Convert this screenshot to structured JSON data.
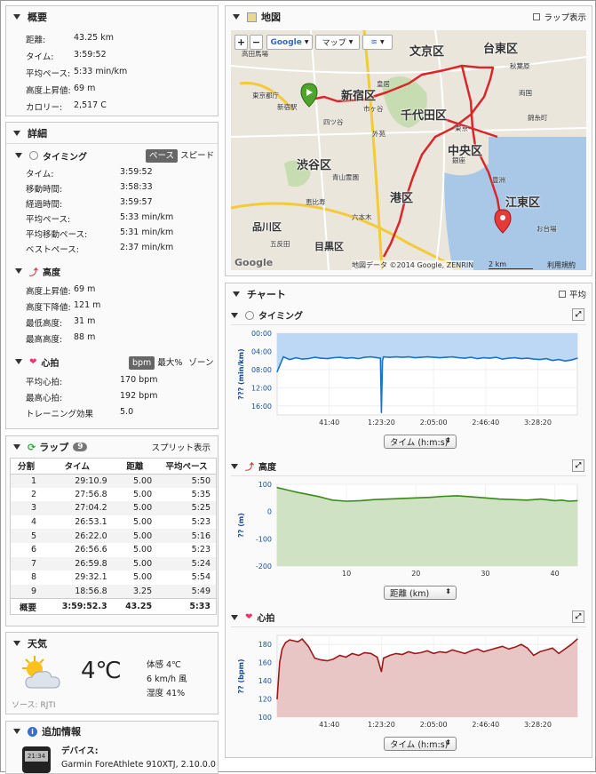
{
  "summary": {
    "title": "概要",
    "rows": [
      {
        "label": "距離:",
        "value": "43.25 km"
      },
      {
        "label": "タイム:",
        "value": "3:59:52"
      },
      {
        "label": "平均ペース:",
        "value": "5:33 min/km"
      },
      {
        "label": "高度上昇値:",
        "value": "69 m"
      },
      {
        "label": "カロリー:",
        "value": "2,517 C"
      }
    ]
  },
  "details": {
    "title": "詳細",
    "timing": {
      "title": "タイミング",
      "toggle_on": "ペース",
      "toggle_off": "スピード",
      "rows": [
        {
          "label": "タイム:",
          "value": "3:59:52"
        },
        {
          "label": "移動時間:",
          "value": "3:58:33"
        },
        {
          "label": "経過時間:",
          "value": "3:59:57"
        },
        {
          "label": "平均ペース:",
          "value": "5:33 min/km"
        },
        {
          "label": "平均移動ペース:",
          "value": "5:31 min/km"
        },
        {
          "label": "ベストペース:",
          "value": "2:37 min/km"
        }
      ]
    },
    "elevation": {
      "title": "高度",
      "rows": [
        {
          "label": "高度上昇値:",
          "value": "69 m"
        },
        {
          "label": "高度下降値:",
          "value": "121 m"
        },
        {
          "label": "最低高度:",
          "value": "31 m"
        },
        {
          "label": "最高高度:",
          "value": "88 m"
        }
      ]
    },
    "heart": {
      "title": "心拍",
      "toggle_on": "bpm",
      "toggle_mid": "最大%",
      "toggle_off": "ゾーン",
      "rows": [
        {
          "label": "平均心拍:",
          "value": "170 bpm"
        },
        {
          "label": "最高心拍:",
          "value": "192 bpm"
        },
        {
          "label": "トレーニング効果",
          "value": "5.0"
        }
      ]
    }
  },
  "laps": {
    "title": "ラップ",
    "count": "9",
    "split_label": "スプリット表示",
    "headers": [
      "分割",
      "タイム",
      "距離",
      "平均ペース"
    ],
    "rows": [
      [
        "1",
        "29:10.9",
        "5.00",
        "5:50"
      ],
      [
        "2",
        "27:56.8",
        "5.00",
        "5:35"
      ],
      [
        "3",
        "27:04.2",
        "5.00",
        "5:25"
      ],
      [
        "4",
        "26:53.1",
        "5.00",
        "5:23"
      ],
      [
        "5",
        "26:22.0",
        "5.00",
        "5:16"
      ],
      [
        "6",
        "26:56.6",
        "5.00",
        "5:23"
      ],
      [
        "7",
        "26:59.8",
        "5.00",
        "5:24"
      ],
      [
        "8",
        "29:32.1",
        "5.00",
        "5:54"
      ],
      [
        "9",
        "18:56.8",
        "3.25",
        "5:49"
      ]
    ],
    "summary": [
      "概要",
      "3:59:52.3",
      "43.25",
      "5:33"
    ]
  },
  "weather": {
    "title": "天気",
    "temp": "4℃",
    "feels": "体感 4℃",
    "wind": "6 km/h 風",
    "humidity": "湿度 41%",
    "source": "ソース: RJTI"
  },
  "extra": {
    "title": "追加情報",
    "device_label": "デバイス:",
    "device": "Garmin ForeAthlete 910XTJ, 2.10.0.0",
    "watch_text": "21:34"
  },
  "map": {
    "title": "地図",
    "lap_label": "ラップ表示",
    "google": "Google",
    "maptype": "マップ",
    "zoom_in": "+",
    "zoom_out": "−",
    "attribution": "地図データ ©2014 Google, ZENRIN",
    "scale": "2 km",
    "terms": "利用規約",
    "google_logo": "Google",
    "labels_big": [
      "文京区",
      "台東区",
      "新宿区",
      "千代田区",
      "中央区",
      "渋谷区",
      "港区",
      "江東区",
      "目黒区",
      "品川区"
    ],
    "labels_small": [
      "高田馬場",
      "新宿駅",
      "四ツ谷",
      "皇居",
      "秋葉原",
      "錦糸町",
      "東京",
      "銀座",
      "豊洲",
      "六本木",
      "恵比寿",
      "五反田",
      "お台場",
      "青山霊園",
      "東京都庁",
      "外苑",
      "両国",
      "市ヶ谷"
    ]
  },
  "chart": {
    "title": "チャート",
    "avg_label": "平均"
  },
  "timing_chart": {
    "title": "タイミング",
    "selector": "タイム (h:m:s)"
  },
  "elev_chart": {
    "title": "高度",
    "selector": "距離 (km)"
  },
  "hr_chart": {
    "title": "心拍",
    "selector": "タイム (h:m:s)"
  },
  "chart_data": [
    {
      "type": "area",
      "title": "タイミング",
      "ylabel": "??? (min/km)",
      "ylim": [
        0,
        18
      ],
      "y_inverted": true,
      "yticks": [
        "00:00",
        "04:00",
        "08:00",
        "12:00",
        "16:00"
      ],
      "xticks": [
        "41:40",
        "1:23:20",
        "2:05:00",
        "2:46:40",
        "3:28:20"
      ],
      "xlabel": "タイム (h:m:s)",
      "xlim_s": [
        0,
        14392
      ],
      "x_s": [
        0,
        300,
        600,
        900,
        1200,
        1500,
        1800,
        2100,
        2400,
        2700,
        3000,
        3300,
        3600,
        3900,
        4200,
        4500,
        4800,
        4950,
        5000,
        5050,
        5100,
        5400,
        5700,
        6000,
        6300,
        6600,
        6900,
        7200,
        7500,
        7800,
        8100,
        8400,
        8700,
        9000,
        9300,
        9600,
        9900,
        10200,
        10500,
        10800,
        11100,
        11400,
        11700,
        12000,
        12300,
        12600,
        12900,
        13200,
        13500,
        13800,
        14100,
        14392
      ],
      "y_pace": [
        8.5,
        5.2,
        5.8,
        5.4,
        5.7,
        5.6,
        5.3,
        5.5,
        5.6,
        5.4,
        5.3,
        5.5,
        5.4,
        5.6,
        5.3,
        5.2,
        5.4,
        5.5,
        17.5,
        6.0,
        5.2,
        5.3,
        5.2,
        5.3,
        5.2,
        5.4,
        5.3,
        5.2,
        5.3,
        5.4,
        5.3,
        5.2,
        5.4,
        5.5,
        5.3,
        5.6,
        5.4,
        5.5,
        5.3,
        5.7,
        5.5,
        5.4,
        5.6,
        5.5,
        5.7,
        5.8,
        5.6,
        6.0,
        5.8,
        6.1,
        5.9,
        5.5
      ],
      "color": "#1a73c8"
    },
    {
      "type": "area",
      "title": "高度",
      "ylabel": "?? (m)",
      "ylim": [
        -200,
        100
      ],
      "yticks": [
        100,
        0,
        -100,
        -200
      ],
      "xlabel": "距離 (km)",
      "xticks": [
        10,
        20,
        30,
        40
      ],
      "xlim": [
        0,
        43.25
      ],
      "x": [
        0,
        1,
        2,
        3,
        4,
        5,
        6,
        7,
        8,
        10,
        12,
        14,
        16,
        18,
        20,
        22,
        24,
        26,
        28,
        30,
        32,
        34,
        36,
        38,
        40,
        41,
        42,
        43.25
      ],
      "y": [
        88,
        82,
        76,
        70,
        65,
        60,
        55,
        48,
        42,
        38,
        40,
        44,
        46,
        48,
        50,
        52,
        56,
        58,
        54,
        50,
        46,
        44,
        42,
        46,
        40,
        42,
        38,
        40
      ],
      "color": "#3a8a1a"
    },
    {
      "type": "area",
      "title": "心拍",
      "ylabel": "?? (bpm)",
      "ylim": [
        100,
        190
      ],
      "yticks": [
        180,
        160,
        140,
        120,
        100
      ],
      "xlabel": "タイム (h:m:s)",
      "xticks": [
        "41:40",
        "1:23:20",
        "2:05:00",
        "2:46:40",
        "3:28:20"
      ],
      "xlim_s": [
        0,
        14392
      ],
      "x_s": [
        0,
        120,
        240,
        400,
        600,
        800,
        1000,
        1200,
        1500,
        1800,
        2100,
        2400,
        2700,
        3000,
        3300,
        3600,
        3900,
        4200,
        4500,
        4800,
        5000,
        5100,
        5400,
        5700,
        6000,
        6300,
        6600,
        6900,
        7200,
        7500,
        7800,
        8100,
        8400,
        8700,
        9000,
        9300,
        9600,
        9900,
        10200,
        10500,
        10800,
        11100,
        11400,
        11700,
        12000,
        12300,
        12600,
        12900,
        13200,
        13500,
        13800,
        14100,
        14392
      ],
      "y": [
        120,
        160,
        175,
        182,
        185,
        184,
        183,
        186,
        178,
        165,
        163,
        162,
        164,
        168,
        166,
        170,
        168,
        171,
        170,
        166,
        150,
        165,
        168,
        170,
        169,
        172,
        170,
        171,
        173,
        170,
        172,
        171,
        174,
        172,
        170,
        173,
        175,
        172,
        174,
        176,
        178,
        175,
        177,
        180,
        176,
        168,
        172,
        174,
        176,
        170,
        175,
        180,
        186
      ],
      "color": "#9b1b1b"
    }
  ]
}
